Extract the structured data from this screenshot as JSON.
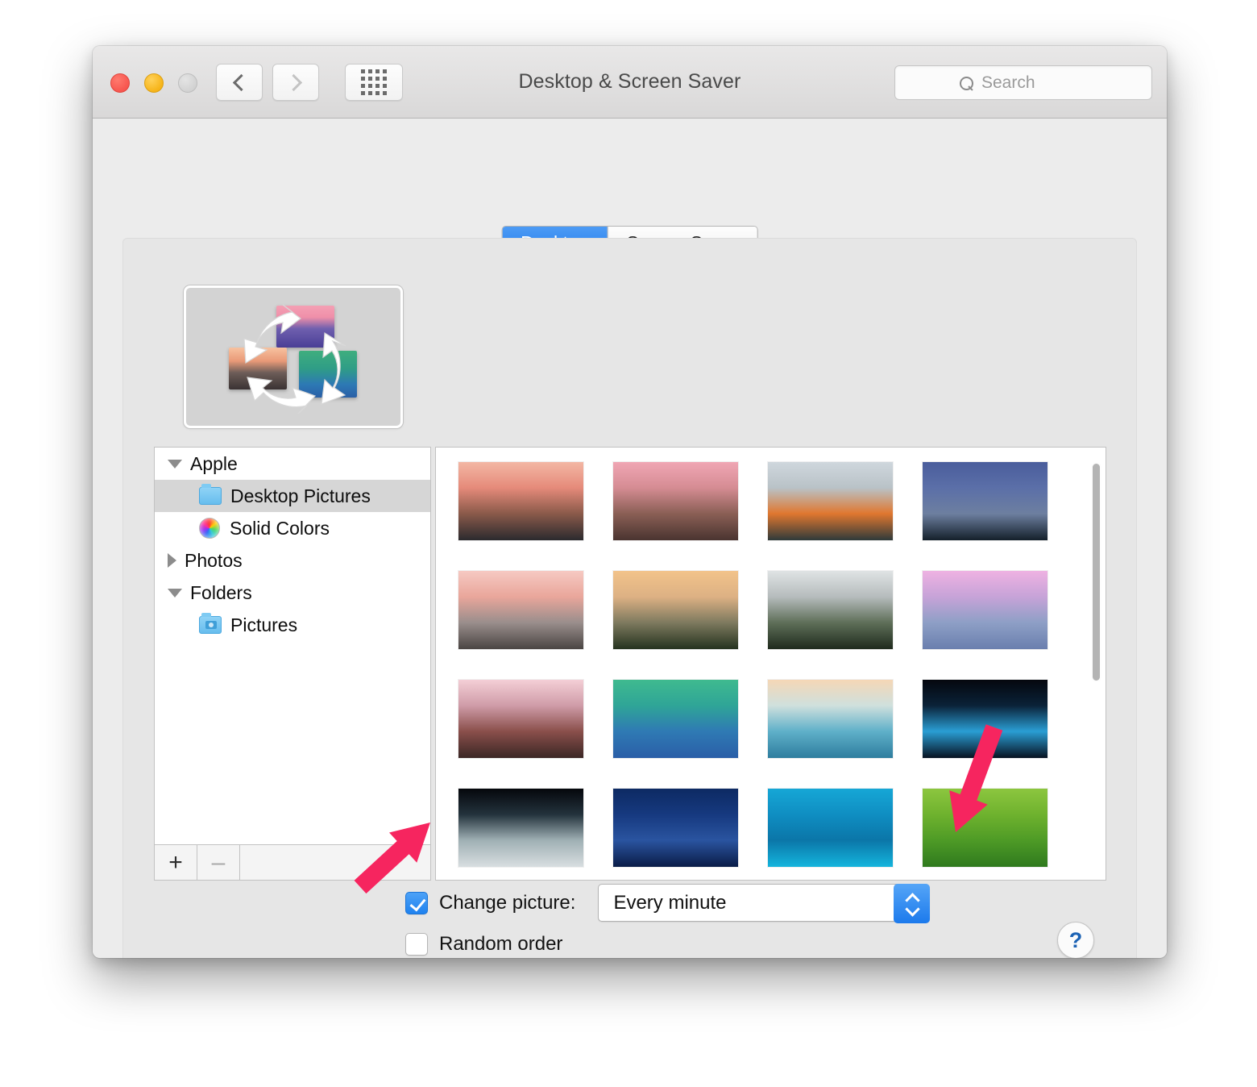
{
  "window": {
    "title": "Desktop & Screen Saver",
    "traffic_lights": [
      "close",
      "minimize",
      "zoom"
    ],
    "toolbar": {
      "back_label": "Back",
      "forward_label": "Forward",
      "showall_label": "Show All",
      "search_placeholder": "Search"
    }
  },
  "tabs": [
    {
      "label": "Desktop",
      "active": true
    },
    {
      "label": "Screen Saver",
      "active": false
    }
  ],
  "preview": {
    "name": "rotating-pictures-preview",
    "caption": ""
  },
  "sidebar": {
    "items": [
      {
        "label": "Apple",
        "level": 0,
        "disclosure": "open",
        "icon": "none",
        "selected": false
      },
      {
        "label": "Desktop Pictures",
        "level": 1,
        "disclosure": "none",
        "icon": "folder-icon",
        "selected": true
      },
      {
        "label": "Solid Colors",
        "level": 1,
        "disclosure": "none",
        "icon": "color-wheel-icon",
        "selected": false
      },
      {
        "label": "Photos",
        "level": 0,
        "disclosure": "closed",
        "icon": "none",
        "selected": false
      },
      {
        "label": "Folders",
        "level": 0,
        "disclosure": "open",
        "icon": "none",
        "selected": false
      },
      {
        "label": "Pictures",
        "level": 1,
        "disclosure": "none",
        "icon": "photo-folder-icon",
        "selected": false
      }
    ],
    "footer": {
      "add_label": "+",
      "remove_label": "–",
      "remove_enabled": false
    }
  },
  "grid": {
    "thumbnails": [
      {
        "name": "sierra-peak",
        "colors": [
          "#f3b7a4",
          "#e58a7a",
          "#8a5a4a",
          "#2b2a2e"
        ]
      },
      {
        "name": "el-capitan-sunset",
        "colors": [
          "#f0a6b4",
          "#d58c93",
          "#8a5f55",
          "#4a3430"
        ]
      },
      {
        "name": "el-capitan-2",
        "colors": [
          "#cfd7dd",
          "#b9c2c7",
          "#e0772f",
          "#2f3a3a"
        ]
      },
      {
        "name": "yosemite-night",
        "colors": [
          "#4a5d9c",
          "#5b6fa8",
          "#6d7fa0",
          "#14202a"
        ]
      },
      {
        "name": "half-dome-dawn",
        "colors": [
          "#f6c9c2",
          "#e9a69b",
          "#9a8e8c",
          "#4a4543"
        ]
      },
      {
        "name": "el-capitan-golden",
        "colors": [
          "#f2c38a",
          "#ddb184",
          "#7e7a5f",
          "#25331f"
        ]
      },
      {
        "name": "yosemite-mist",
        "colors": [
          "#dfe3e4",
          "#b6bcbd",
          "#5f6f59",
          "#1f2b1d"
        ]
      },
      {
        "name": "half-dome-pink",
        "colors": [
          "#eeb2e2",
          "#c7a3d8",
          "#8e9fc6",
          "#6a7fae"
        ]
      },
      {
        "name": "lake-sunrise",
        "colors": [
          "#f4cfd6",
          "#cf9ca8",
          "#8a4f4b",
          "#3b2725"
        ]
      },
      {
        "name": "mavericks-wave-green",
        "colors": [
          "#3fba8f",
          "#2fa597",
          "#2f7ab4",
          "#2a5ea7"
        ]
      },
      {
        "name": "wave-sunrise",
        "colors": [
          "#f5d7b6",
          "#cfe0dd",
          "#5fb0c9",
          "#2e7d9e"
        ]
      },
      {
        "name": "earth-moon",
        "colors": [
          "#05070e",
          "#0a2238",
          "#2a9ed4",
          "#081221"
        ]
      },
      {
        "name": "earth-horizon",
        "colors": [
          "#05070c",
          "#23323c",
          "#9fb0b4",
          "#d8dee0"
        ]
      },
      {
        "name": "milky-way",
        "colors": [
          "#0d2a63",
          "#16397f",
          "#2a54a0",
          "#0a1c47"
        ]
      },
      {
        "name": "blue-river-delta",
        "colors": [
          "#16a7d6",
          "#0f8ec2",
          "#0b76a8",
          "#14b5dd"
        ]
      },
      {
        "name": "green-fields",
        "colors": [
          "#8cc63f",
          "#6fb22e",
          "#4e9b26",
          "#2f7a1e"
        ]
      },
      {
        "name": "misty-forest",
        "colors": [
          "#e3d9b6",
          "#cfc193",
          "#9a9366",
          "#6c6a48"
        ]
      },
      {
        "name": "mountain-layers",
        "colors": [
          "#b7d3e4",
          "#8fa8b8",
          "#4f6655",
          "#1d2a1e"
        ]
      },
      {
        "name": "frozen-river",
        "colors": [
          "#e6eef4",
          "#cddbe6",
          "#3f77a8",
          "#8fb3cc"
        ]
      },
      {
        "name": "soft-clouds",
        "colors": [
          "#f4f6fa",
          "#e2e6f0",
          "#c9cfe0",
          "#b8bfd4"
        ]
      }
    ],
    "scrollbar": {
      "name": "grid-scrollbar"
    }
  },
  "controls": {
    "change_picture": {
      "label": "Change picture:",
      "checked": true,
      "interval_value": "Every minute"
    },
    "random_order": {
      "label": "Random order",
      "checked": false
    },
    "help_label": "?"
  },
  "annotations": {
    "arrow_color": "#F6255F",
    "arrows": [
      {
        "name": "arrow-to-change-picture-checkbox",
        "points_to": "change-picture-checkbox"
      },
      {
        "name": "arrow-to-interval-stepper",
        "points_to": "interval-stepper"
      }
    ]
  }
}
